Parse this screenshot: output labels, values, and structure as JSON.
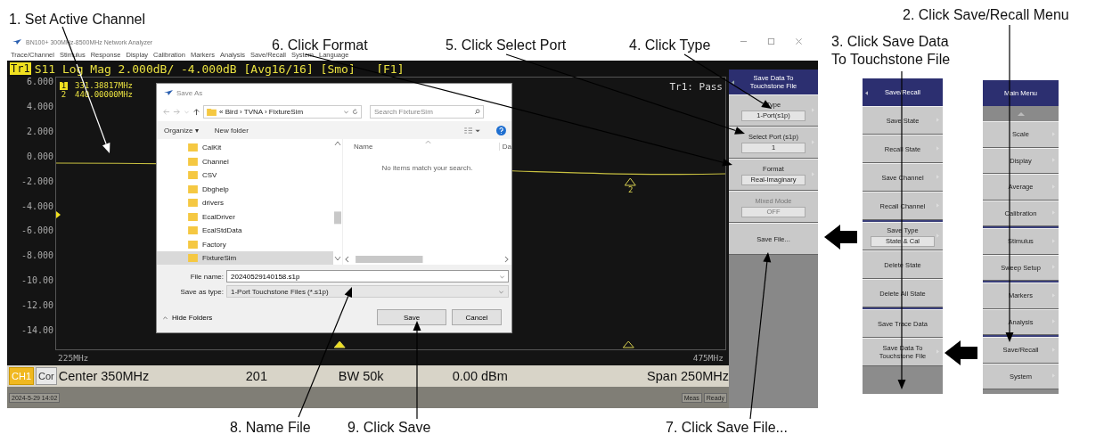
{
  "callouts": [
    {
      "lines": [
        "1. Set Active Channel"
      ]
    },
    {
      "lines": [
        "2. Click Save/Recall Menu"
      ]
    },
    {
      "lines": [
        "6. Click Format"
      ]
    },
    {
      "lines": [
        "5. Click Select Port"
      ]
    },
    {
      "lines": [
        "4. Click Type"
      ]
    },
    {
      "lines": [
        "3. Click Save Data",
        "To Touchstone File"
      ]
    },
    {
      "lines": [
        "8. Name File"
      ]
    },
    {
      "lines": [
        "9. Click Save"
      ]
    },
    {
      "lines": [
        "7. Click Save File..."
      ]
    }
  ],
  "analyzer": {
    "title": "BN100+ 300MHz-8500MHz Network Analyzer",
    "menu": [
      "Trace/Channel",
      "Stimulus",
      "Response",
      "Display",
      "Calibration",
      "Markers",
      "Analysis",
      "Save/Recall",
      "System",
      "Language"
    ],
    "trace": {
      "badge": "Tr1",
      "header": "S11 Log Mag 2.000dB/ -4.000dB [Avg16/16] [Smo]   [F1]",
      "status": "Tr1: Pass"
    },
    "markers": [
      {
        "num": "1",
        "freq": "331.38817MHz",
        "selected": true
      },
      {
        "num": "2",
        "freq": "440.00000MHz",
        "selected": false
      }
    ],
    "trace_marker_label": "2",
    "y_labels": [
      "6.000",
      "4.000",
      "2.000",
      "0.000",
      "-2.000",
      "-4.000",
      "-6.000",
      "-8.000",
      "-10.00",
      "-12.00",
      "-14.00"
    ],
    "x_start": "225MHz",
    "x_stop": "475MHz",
    "channel_bar": {
      "channel": "CH1",
      "correction": "Cor",
      "center": "Center 350MHz",
      "points": "201",
      "bandwidth": "BW 50k",
      "power": "0.00 dBm",
      "span": "Span 250MHz"
    },
    "status_bar": {
      "datetime": "2024-5-29 14:02",
      "indicators": [
        "Meas",
        "Ready"
      ]
    }
  },
  "softkeys": {
    "title": "Save Data To Touchstone File",
    "back": true,
    "items": [
      {
        "label": "Type",
        "value": "1-Port(s1p)",
        "disabled": false,
        "submenu": true
      },
      {
        "label": "Select Port (s1p)",
        "value": "1",
        "disabled": false,
        "submenu": true
      },
      {
        "label": "Format",
        "value": "Real-Imaginary",
        "disabled": false,
        "submenu": true
      },
      {
        "label": "Mixed Mode",
        "value": "OFF",
        "disabled": true,
        "submenu": false
      },
      {
        "label": "Save File...",
        "disabled": false,
        "submenu": false
      }
    ]
  },
  "save_recall_menu": {
    "title": "Save/Recall",
    "back": true,
    "groups": [
      [
        {
          "label": "Save State",
          "submenu": true
        },
        {
          "label": "Recall State",
          "submenu": true
        },
        {
          "label": "Save Channel",
          "submenu": true
        },
        {
          "label": "Recall Channel",
          "submenu": true
        }
      ],
      [
        {
          "label": "Save Type",
          "value": "State & Cal",
          "submenu": true
        },
        {
          "label": "Delete State",
          "submenu": false
        },
        {
          "label": "Delete All State",
          "submenu": false
        }
      ],
      [
        {
          "label": "Save Trace Data",
          "submenu": false
        },
        {
          "label": "Save Data To Touchstone File",
          "submenu": true
        }
      ]
    ]
  },
  "main_menu": {
    "title": "Main Menu",
    "back": false,
    "groups": [
      [
        {
          "label": "Scale",
          "submenu": true
        },
        {
          "label": "Display",
          "submenu": true
        },
        {
          "label": "Average",
          "submenu": true
        },
        {
          "label": "Calibration",
          "submenu": true
        }
      ],
      [
        {
          "label": "Stimulus",
          "submenu": true
        },
        {
          "label": "Sweep Setup",
          "submenu": true
        }
      ],
      [
        {
          "label": "Markers",
          "submenu": true
        },
        {
          "label": "Analysis",
          "submenu": true
        }
      ],
      [
        {
          "label": "Save/Recall",
          "submenu": true
        },
        {
          "label": "System",
          "submenu": true
        }
      ]
    ]
  },
  "dialog": {
    "title": "Save As",
    "path": "« Bird › TVNA › FixtureSim",
    "search_placeholder": "Search FixtureSim",
    "toolbar": [
      "Organize ▾",
      "New folder"
    ],
    "folders": [
      {
        "name": "CalKit",
        "selected": false
      },
      {
        "name": "Channel",
        "selected": false
      },
      {
        "name": "CSV",
        "selected": false
      },
      {
        "name": "Dbghelp",
        "selected": false
      },
      {
        "name": "drivers",
        "selected": false
      },
      {
        "name": "EcalDriver",
        "selected": false
      },
      {
        "name": "EcalStdData",
        "selected": false
      },
      {
        "name": "Factory",
        "selected": false
      },
      {
        "name": "FixtureSim",
        "selected": true
      }
    ],
    "columns": [
      "Name",
      "Da"
    ],
    "empty_message": "No items match your search.",
    "file_name_label": "File name:",
    "file_name": "20240529140158.s1p",
    "type_label": "Save as type:",
    "type": "1-Port Touchstone Files (*.s1p)",
    "hide_folders": "Hide Folders",
    "buttons": [
      "Save",
      "Cancel"
    ]
  }
}
